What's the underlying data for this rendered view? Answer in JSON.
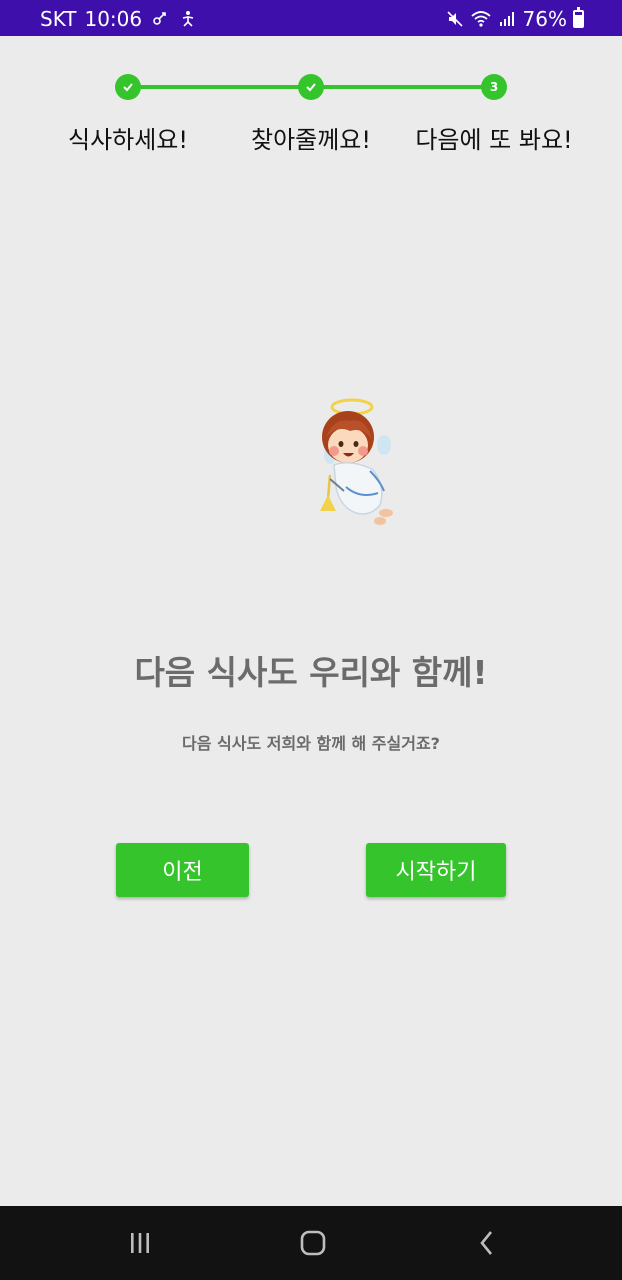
{
  "status_bar": {
    "carrier": "SKT",
    "time": "10:06",
    "left_icons": [
      "link-icon",
      "accessibility-icon"
    ],
    "right_icons": [
      "mute-icon",
      "wifi-icon",
      "signal-icon"
    ],
    "battery_percent": "76%",
    "battery_level": 0.76,
    "color": "#3f0fab"
  },
  "stepper": {
    "steps": [
      {
        "label": "식사하세요!",
        "state": "done",
        "icon": "check-icon"
      },
      {
        "label": "찾아줄께요!",
        "state": "done",
        "icon": "check-icon"
      },
      {
        "label": "다음에 또 봐요!",
        "state": "current",
        "number": "3"
      }
    ],
    "accent_color": "#35c42b"
  },
  "illustration": {
    "icon": "angel-illustration"
  },
  "content": {
    "title": "다음 식사도 우리와 함께!",
    "subtitle": "다음 식사도 저희와 함께 해 주실거죠?"
  },
  "buttons": {
    "prev_label": "이전",
    "start_label": "시작하기"
  },
  "nav_bar": {
    "icons": [
      "recent-apps-icon",
      "home-icon",
      "back-icon"
    ]
  }
}
